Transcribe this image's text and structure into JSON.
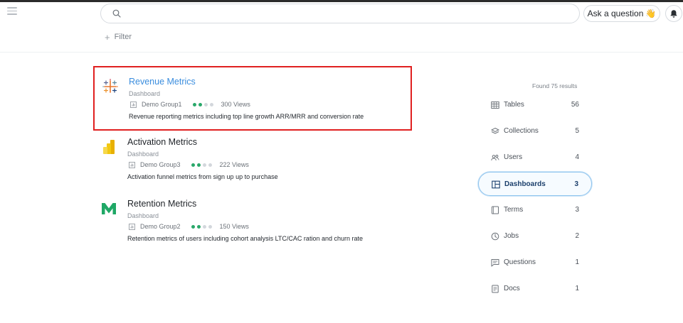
{
  "header": {
    "search_placeholder": "",
    "ask_label": "Ask a question",
    "ask_emoji": "👋"
  },
  "filter": {
    "label": "Filter",
    "plus": "+"
  },
  "results": [
    {
      "title": "Revenue Metrics",
      "type": "Dashboard",
      "group": "Demo Group1",
      "rating": 2,
      "rating_max": 4,
      "views": "300 Views",
      "description": "Revenue reporting metrics including top line growth ARR/MRR and conversion rate",
      "logo": "tableau-icon"
    },
    {
      "title": "Activation Metrics",
      "type": "Dashboard",
      "group": "Demo Group3",
      "rating": 2,
      "rating_max": 4,
      "views": "222 Views",
      "description": "Activation funnel metrics from sign up up to purchase",
      "logo": "powerbi-icon"
    },
    {
      "title": "Retention Metrics",
      "type": "Dashboard",
      "group": "Demo Group2",
      "rating": 2,
      "rating_max": 4,
      "views": "150 Views",
      "description": "Retention metrics of users including cohort analysis LTC/CAC ration and churn rate",
      "logo": "metabase-m-icon"
    }
  ],
  "facets": {
    "found": "Found 75 results",
    "items": [
      {
        "label": "Tables",
        "count": "56",
        "icon": "table-icon"
      },
      {
        "label": "Collections",
        "count": "5",
        "icon": "layers-icon"
      },
      {
        "label": "Users",
        "count": "4",
        "icon": "users-icon"
      },
      {
        "label": "Dashboards",
        "count": "3",
        "icon": "dashboard-icon",
        "active": true
      },
      {
        "label": "Terms",
        "count": "3",
        "icon": "book-icon"
      },
      {
        "label": "Jobs",
        "count": "2",
        "icon": "clock-icon"
      },
      {
        "label": "Questions",
        "count": "1",
        "icon": "chat-icon"
      },
      {
        "label": "Docs",
        "count": "1",
        "icon": "doc-icon"
      }
    ]
  },
  "colors": {
    "link": "#3a8dde",
    "highlight_border": "#e02020",
    "rating_on": "#2aa86a",
    "rating_off": "#d3d7dc",
    "active_facet_border": "#8fc4ee"
  }
}
